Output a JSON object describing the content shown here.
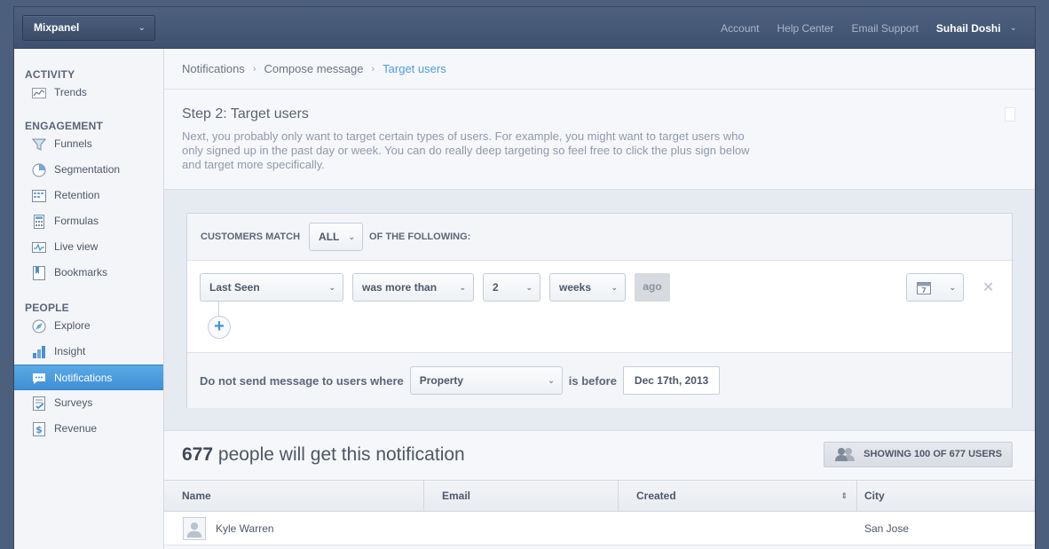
{
  "topbar": {
    "project": "Mixpanel",
    "links": [
      "Account",
      "Help Center",
      "Email Support"
    ],
    "user": "Suhail Doshi"
  },
  "sidebar": {
    "sections": [
      {
        "title": "ACTIVITY",
        "items": [
          {
            "label": "Trends",
            "icon": "trends-icon"
          }
        ]
      },
      {
        "title": "ENGAGEMENT",
        "items": [
          {
            "label": "Funnels",
            "icon": "funnel-icon"
          },
          {
            "label": "Segmentation",
            "icon": "pie-chart-icon"
          },
          {
            "label": "Retention",
            "icon": "grid-icon"
          },
          {
            "label": "Formulas",
            "icon": "calculator-icon"
          },
          {
            "label": "Live view",
            "icon": "pulse-icon"
          },
          {
            "label": "Bookmarks",
            "icon": "bookmark-icon"
          }
        ]
      },
      {
        "title": "PEOPLE",
        "items": [
          {
            "label": "Explore",
            "icon": "compass-icon"
          },
          {
            "label": "Insight",
            "icon": "bar-chart-icon"
          },
          {
            "label": "Notifications",
            "icon": "chat-bubble-icon",
            "active": true
          },
          {
            "label": "Surveys",
            "icon": "checklist-icon"
          },
          {
            "label": "Revenue",
            "icon": "dollar-icon"
          }
        ]
      }
    ]
  },
  "breadcrumb": [
    "Notifications",
    "Compose message",
    "Target users"
  ],
  "step": {
    "title": "Step 2: Target users",
    "description": "Next, you probably only want to target certain types of users. For example, you might want to target users who only signed up in the past day or week. You can do really deep targeting so feel free to click the plus sign below and target more specifically."
  },
  "builder": {
    "match_prefix": "CUSTOMERS MATCH",
    "match_value": "ALL",
    "match_suffix": "OF THE FOLLOWING:",
    "filter": {
      "property": "Last Seen",
      "operator": "was more than",
      "amount": "2",
      "unit": "weeks",
      "suffix": "ago"
    },
    "exclude": {
      "prefix": "Do not send message to users where",
      "property": "Property",
      "operator": "is before",
      "date": "Dec 17th, 2013"
    }
  },
  "results": {
    "count": "677",
    "count_text": "people will get this notification",
    "showing": "SHOWING 100 OF 677 USERS"
  },
  "table": {
    "columns": [
      "Name",
      "Email",
      "Created",
      "City"
    ],
    "rows": [
      {
        "name": "Kyle Warren",
        "email": "",
        "created": "",
        "city": "San Jose"
      }
    ]
  },
  "colors": {
    "accent": "#4a9de0",
    "active_nav": "#4c9fe0",
    "topbar": "#465a78"
  }
}
